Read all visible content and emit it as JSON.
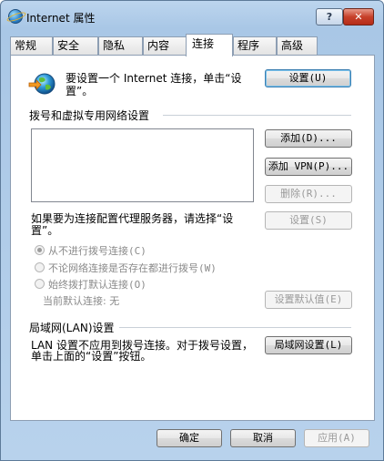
{
  "window": {
    "title": "Internet 属性",
    "help_label": "?",
    "close_label": "✕"
  },
  "tabs": [
    {
      "label": "常规"
    },
    {
      "label": "安全"
    },
    {
      "label": "隐私"
    },
    {
      "label": "内容"
    },
    {
      "label": "连接",
      "active": true
    },
    {
      "label": "程序"
    },
    {
      "label": "高级"
    }
  ],
  "intro": {
    "text": "要设置一个 Internet 连接，单击“设置”。",
    "setup_button": "设置(U)"
  },
  "dialup": {
    "heading": "拨号和虚拟专用网络设置",
    "add_button": "添加(D)...",
    "add_vpn_button": "添加 VPN(P)...",
    "remove_button": "删除(R)...",
    "proxy_text": "如果要为连接配置代理服务器，请选择“设置”。",
    "settings_button": "设置(S)",
    "options": [
      {
        "label": "从不进行拨号连接(C)",
        "checked": true
      },
      {
        "label": "不论网络连接是否存在都进行拨号(W)",
        "checked": false
      },
      {
        "label": "始终拨打默认连接(O)",
        "checked": false
      }
    ],
    "current_default": "当前默认连接:  无",
    "set_default_button": "设置默认值(E)"
  },
  "lan": {
    "heading": "局域网(LAN)设置",
    "text": "LAN 设置不应用到拨号连接。对于拨号设置，单击上面的“设置”按钮。",
    "lan_button": "局域网设置(L)"
  },
  "footer": {
    "ok_button": "确定",
    "cancel_button": "取消",
    "apply_button": "应用(A)"
  }
}
